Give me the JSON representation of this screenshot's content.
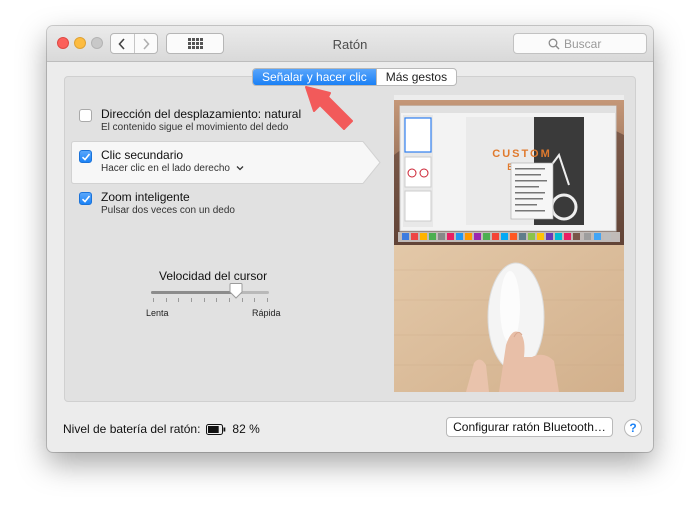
{
  "window": {
    "title": "Ratón"
  },
  "toolbar": {
    "back_icon": "chevron-left-icon",
    "forward_icon": "chevron-right-icon",
    "show_all_icon": "grid-icon",
    "search_placeholder": "Buscar"
  },
  "tabs": [
    {
      "label": "Señalar y hacer clic",
      "selected": true
    },
    {
      "label": "Más gestos",
      "selected": false
    }
  ],
  "options": [
    {
      "title": "Dirección del desplazamiento: natural",
      "subtitle": "El contenido sigue el movimiento del dedo",
      "checked": false
    },
    {
      "title": "Clic secundario",
      "subtitle": "Hacer clic en el lado derecho",
      "checked": true,
      "has_dropdown": true
    },
    {
      "title": "Zoom inteligente",
      "subtitle": "Pulsar dos veces con un dedo",
      "checked": true
    }
  ],
  "tracking": {
    "label": "Velocidad del cursor",
    "min_label": "Lenta",
    "max_label": "Rápida",
    "level": 0.72
  },
  "preview": {
    "poster_title": "CUSTOM BIKES"
  },
  "footer": {
    "battery_label": "Nivel de batería del ratón:",
    "battery_value": "82 %",
    "battery_level": 0.82,
    "configure_button": "Configurar ratón Bluetooth…",
    "help_button": "?"
  },
  "colors": {
    "accent": "#1b82f6",
    "annotation_arrow": "#f25a5a"
  }
}
